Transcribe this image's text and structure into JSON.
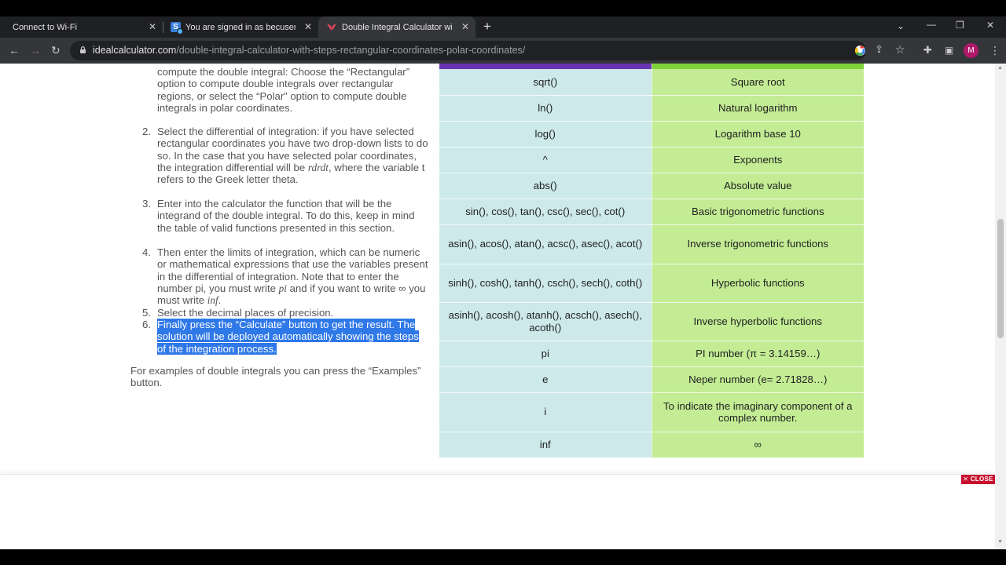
{
  "browser": {
    "tabs": [
      {
        "title": "Connect to Wi-Fi"
      },
      {
        "title": "You are signed in as becuser"
      },
      {
        "title": "Double Integral Calculator with steps"
      }
    ],
    "url_domain": "idealcalculator.com",
    "url_path": "/double-integral-calculator-with-steps-rectangular-coordinates-polar-coordinates/",
    "profile_initial": "M",
    "favicon_letter": "S",
    "icons": [
      "close-icon",
      "plus-icon",
      "chevron-down-icon",
      "minimize-icon",
      "restore-icon",
      "back-icon",
      "forward-icon",
      "reload-icon",
      "lock-icon",
      "google-icon",
      "share-icon",
      "star-icon",
      "extensions-icon",
      "sidepanel-icon",
      "more-icon"
    ]
  },
  "steps": {
    "s1_tail": "compute the double integral: Choose the “Rectangular” option to compute double integrals over rectangular regions, or select the “Polar” option to compute double integrals in polar coordinates.",
    "s2_num": "2.",
    "s2_a": "Select the differential of integration: if you have selected rectangular coordinates you have two drop-down lists to do so. In the case that you have selected polar coordinates, the integration differential will be ",
    "s2_var": "rdrdt",
    "s2_b": ", where the variable t refers to the Greek letter theta.",
    "s3_num": "3.",
    "s3": "Enter into the calculator the function that will be the integrand of the double integral. To do this, keep in mind the table of valid functions presented in this section.",
    "s4_num": "4.",
    "s4_a": "Then enter the limits of integration, which can be numeric or mathematical expressions that use the variables present in the differential of integration. Note that to enter the number pi, you must write ",
    "s4_pi": "pi",
    "s4_b": " and if you want to write ∞ you must write ",
    "s4_inf": "inf",
    "s4_c": ".",
    "s5_num": "5.",
    "s5": "Select the decimal places of precision.",
    "s6_num": "6.",
    "s6": "Finally press the “Calculate” button to get the result. The solution will be deployed automatically showing the steps of the integration process."
  },
  "footnote": "For examples of double integrals you can press the “Examples” button.",
  "functions": [
    {
      "fn": "sqrt()",
      "desc": "Square root"
    },
    {
      "fn": "ln()",
      "desc": "Natural logarithm"
    },
    {
      "fn": "log()",
      "desc": "Logarithm base 10"
    },
    {
      "fn": "^",
      "desc": "Exponents"
    },
    {
      "fn": "abs()",
      "desc": "Absolute value"
    },
    {
      "fn": "sin(), cos(), tan(), csc(), sec(), cot()",
      "desc": "Basic trigonometric functions"
    },
    {
      "fn": "asin(), acos(), atan(), acsc(), asec(), acot()",
      "desc": "Inverse trigonometric functions"
    },
    {
      "fn": "sinh(), cosh(), tanh(), csch(), sech(), coth()",
      "desc": "Hyperbolic functions"
    },
    {
      "fn": "asinh(), acosh(), atanh(), acsch(), asech(), acoth()",
      "desc": "Inverse hyperbolic functions"
    },
    {
      "fn": "pi",
      "desc": "PI number (π = 3.14159…)"
    },
    {
      "fn": "e",
      "desc": "Neper number (e= 2.71828…)"
    },
    {
      "fn": "i",
      "desc": "To indicate the imaginary component of a complex number."
    },
    {
      "fn": "inf",
      "desc": "∞"
    }
  ],
  "ad": {
    "close_label": "✕ CLOSE"
  },
  "colors": {
    "header_left": "#6a33b4",
    "header_right": "#7fd13a",
    "col_left": "#cde9ea",
    "col_right": "#c3ec94",
    "selection": "#2f78e8",
    "close_button": "#c8102e"
  }
}
